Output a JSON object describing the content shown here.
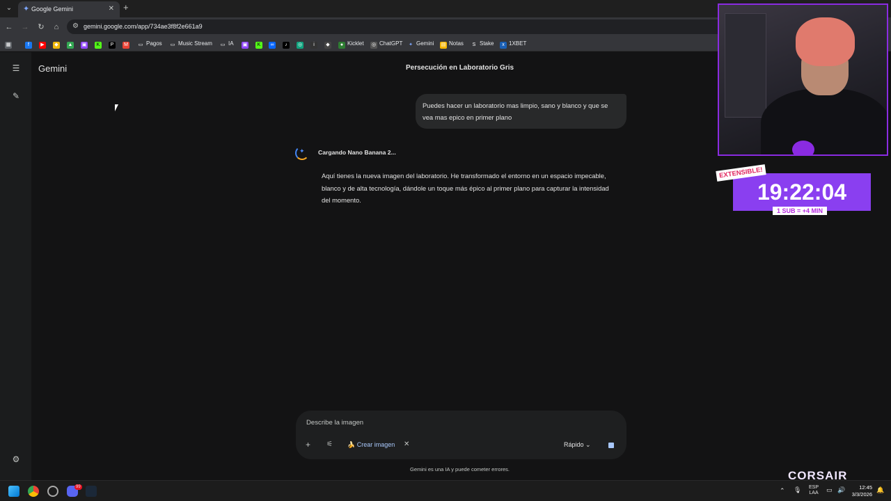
{
  "browser": {
    "tab_title": "Google Gemini",
    "url": "gemini.google.com/app/734ae3f8f2e661a9",
    "bookmarks": [
      "Pagos",
      "Music Stream",
      "IA",
      "Kicklet",
      "ChatGPT",
      "Gemini",
      "Notas",
      "Stake",
      "1XBET"
    ]
  },
  "app": {
    "brand": "Gemini",
    "chat_title": "Persecución en Laboratorio Gris",
    "user_message": "Puedes hacer un laboratorio mas limpio, sano y blanco y que se vea mas epico en primer plano",
    "loading_text": "Cargando Nano Banana 2...",
    "assistant_message": "Aquí tienes la nueva imagen del laboratorio. He transformado el entorno en un espacio impecable, blanco y de alta tecnología, dándole un toque más épico al primer plano para capturar la intensidad del momento.",
    "composer_placeholder": "Describe la imagen",
    "tool_chip": "Crear imagen",
    "mode": "Rápido",
    "disclaimer": "Gemini es una IA y puede cometer errores."
  },
  "overlay": {
    "extensible_label": "EXTENSIBLE!",
    "timer": "19:22:04",
    "sub_rule": "1 SUB = +4 MIN",
    "sponsor": "CORSAIR"
  },
  "taskbar": {
    "lang_top": "ESP",
    "lang_bottom": "LAA",
    "time": "12:45",
    "date": "3/3/2026",
    "discord_badge": "99"
  },
  "colors": {
    "background": "#131314",
    "accent": "#a8c7fa",
    "overlay_purple": "#8a3ff0"
  }
}
